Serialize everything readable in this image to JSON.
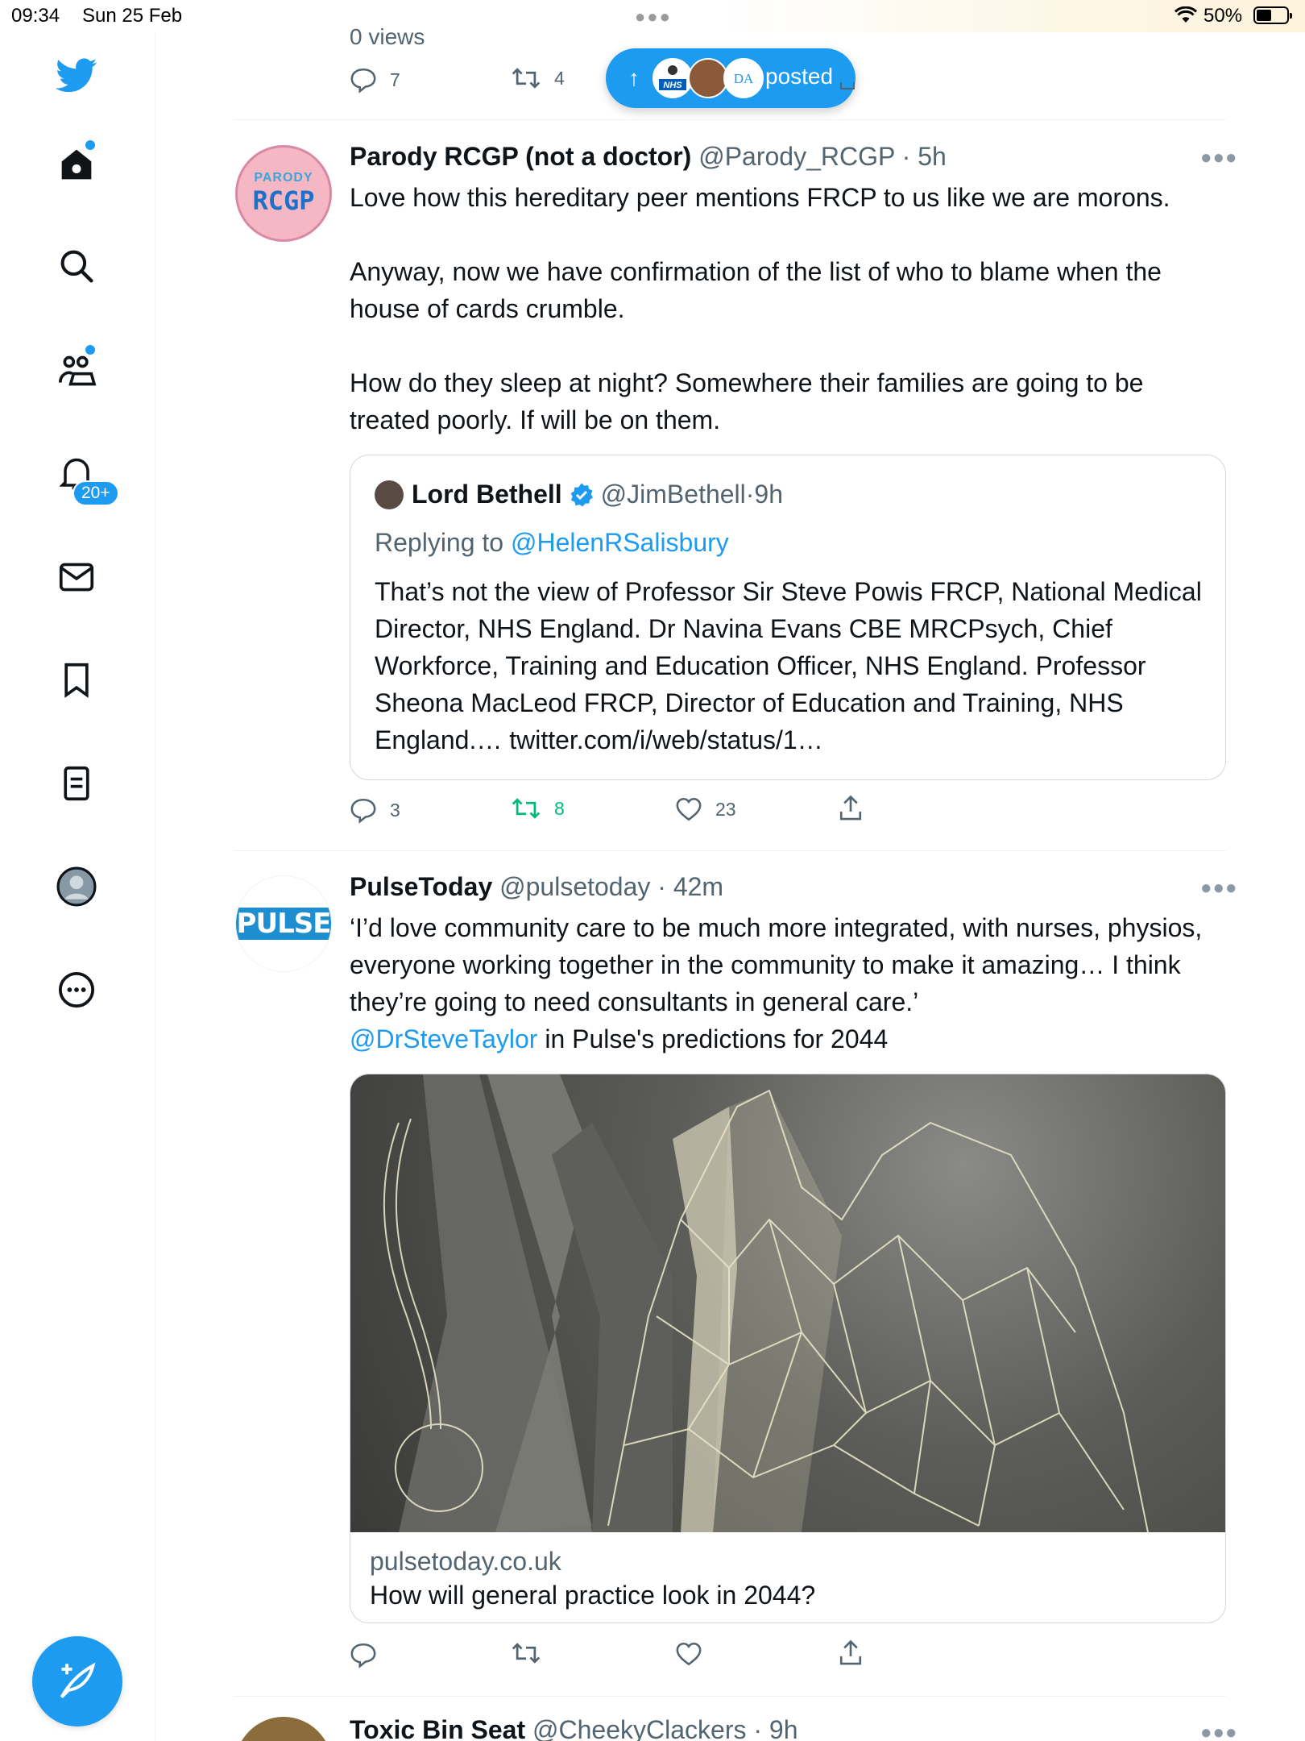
{
  "status_bar": {
    "time": "09:34",
    "date": "Sun 25 Feb",
    "battery": "50%"
  },
  "sidebar": {
    "items": [
      {
        "icon": "twitter-logo-icon"
      },
      {
        "icon": "home-icon"
      },
      {
        "icon": "search-icon"
      },
      {
        "icon": "communities-icon"
      },
      {
        "icon": "notifications-icon",
        "badge": "20+"
      },
      {
        "icon": "messages-icon"
      },
      {
        "icon": "bookmarks-icon"
      },
      {
        "icon": "lists-icon"
      },
      {
        "icon": "profile-icon"
      },
      {
        "icon": "more-icon"
      }
    ],
    "compose_icon": "compose-icon"
  },
  "previous_tweet": {
    "views_text": "0 views",
    "replies": "7",
    "retweets": "4"
  },
  "new_posts_pill": {
    "label": "posted"
  },
  "tweet1": {
    "avatar_text_top": "PARODY",
    "avatar_text_main": "RCGP",
    "name": "Parody RCGP (not a doctor)",
    "handle": "@Parody_RCGP",
    "time": "5h",
    "text": "Love how this hereditary peer mentions FRCP to us like we are morons.\n\nAnyway, now we have confirmation of the list of who to blame when the house of cards crumble.\n\nHow do they sleep at night? Somewhere their families are going to be treated poorly. If will be on them.",
    "quote": {
      "name": "Lord Bethell",
      "handle": "@JimBethell",
      "time": "9h",
      "replying_prefix": "Replying to ",
      "replying_to": "@HelenRSalisbury",
      "text": "That’s not the view of Professor Sir Steve Powis FRCP, National Medical Director, NHS England. Dr Navina Evans CBE MRCPsych, Chief Workforce, Training and Education Officer, NHS England. Professor Sheona MacLeod FRCP, Director of Education and Training, NHS England.… twitter.com/i/web/status/1…"
    },
    "replies": "3",
    "retweets": "8",
    "likes": "23"
  },
  "tweet2": {
    "avatar_text": "PULSE",
    "name": "PulseToday",
    "handle": "@pulsetoday",
    "time": "42m",
    "text": "‘I’d love community care to be much more integrated, with nurses, physios, everyone working together in the community to make it amazing… I think they’re going to need consultants in general care.’",
    "mention": "@DrSteveTaylor",
    "text_tail": " in Pulse's predictions for 2044",
    "card": {
      "domain": "pulsetoday.co.uk",
      "title": "How will general practice look in 2044?"
    }
  },
  "tweet3": {
    "name": "Toxic Bin Seat",
    "handle": "@CheekyClackers",
    "time": "9h"
  },
  "colors": {
    "accent": "#1d9bf0",
    "retweet_active": "#00ba7c",
    "text_secondary": "#536471",
    "border": "#cfd9de"
  }
}
